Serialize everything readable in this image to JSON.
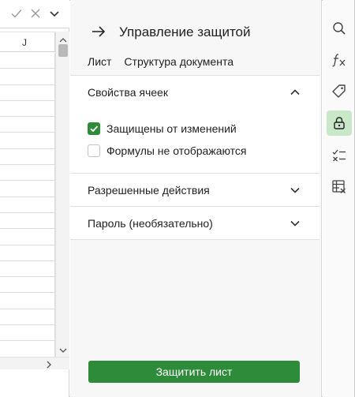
{
  "sheet": {
    "column_header": "J",
    "formula_bar": {
      "confirm_icon": "check-icon",
      "cancel_icon": "close-icon",
      "expand_icon": "chevron-down-icon"
    }
  },
  "panel": {
    "title": "Управление защитой",
    "tabs": [
      {
        "label": "Лист",
        "active": true
      },
      {
        "label": "Структура документа",
        "active": false
      }
    ],
    "sections": [
      {
        "title": "Свойства ячеек",
        "expanded": true,
        "options": [
          {
            "label": "Защищены от изменений",
            "checked": true
          },
          {
            "label": "Формулы не отображаются",
            "checked": false
          }
        ]
      },
      {
        "title": "Разрешенные действия",
        "expanded": false
      },
      {
        "title": "Пароль (необязательно)",
        "expanded": false
      }
    ],
    "primary_button": "Защитить лист"
  },
  "rail": {
    "items": [
      "search-icon",
      "function-icon",
      "tag-icon",
      "lock-icon",
      "checklist-icon",
      "table-icon"
    ],
    "active": "lock-icon"
  },
  "colors": {
    "accent": "#2e8b3a",
    "active_rail_bg": "#c9e7c9"
  }
}
